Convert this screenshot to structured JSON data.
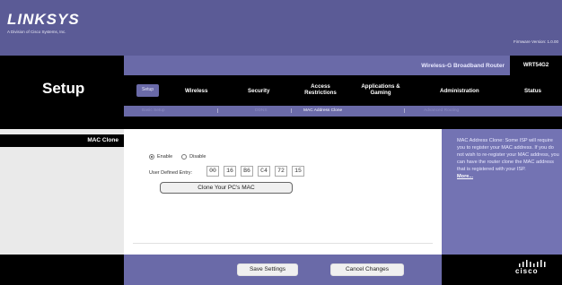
{
  "brand": {
    "logo_text": "LINKSYS",
    "subtitle": "A Division of Cisco Systems, Inc.",
    "firmware": "Firmware Version: 1.0.00"
  },
  "section_title": "Setup",
  "product": {
    "name": "Wireless-G Broadband Router",
    "model": "WRT54G2"
  },
  "tabs": [
    {
      "label": "Setup",
      "active": true
    },
    {
      "label": "Wireless"
    },
    {
      "label": "Security"
    },
    {
      "label": "Access Restrictions"
    },
    {
      "label": "Applications & Gaming"
    },
    {
      "label": "Administration"
    },
    {
      "label": "Status"
    }
  ],
  "subtabs": [
    {
      "label": "Basic Setup"
    },
    {
      "label": "DDNS"
    },
    {
      "label": "MAC Address Clone",
      "active": true
    },
    {
      "label": "Advanced Routing"
    }
  ],
  "mac_clone": {
    "section_label": "MAC Clone",
    "enable_label": "Enable",
    "disable_label": "Disable",
    "enabled": true,
    "user_defined_label": "User Defined Entry:",
    "mac_octets": [
      "00",
      "16",
      "B6",
      "C4",
      "72",
      "15"
    ],
    "clone_button": "Clone Your PC's MAC"
  },
  "help": {
    "text": "MAC Address Clone: Some ISP will require you to register your MAC address. If you do not wish to re-register your MAC address, you can have the router clone the MAC address that is registered with your ISP.",
    "more": "More..."
  },
  "footer": {
    "save": "Save Settings",
    "cancel": "Cancel Changes",
    "cisco": "cisco"
  },
  "colors": {
    "header_purple": "#5b5b96",
    "nav_purple": "#6a6aa8",
    "help_purple": "#7373b3"
  }
}
